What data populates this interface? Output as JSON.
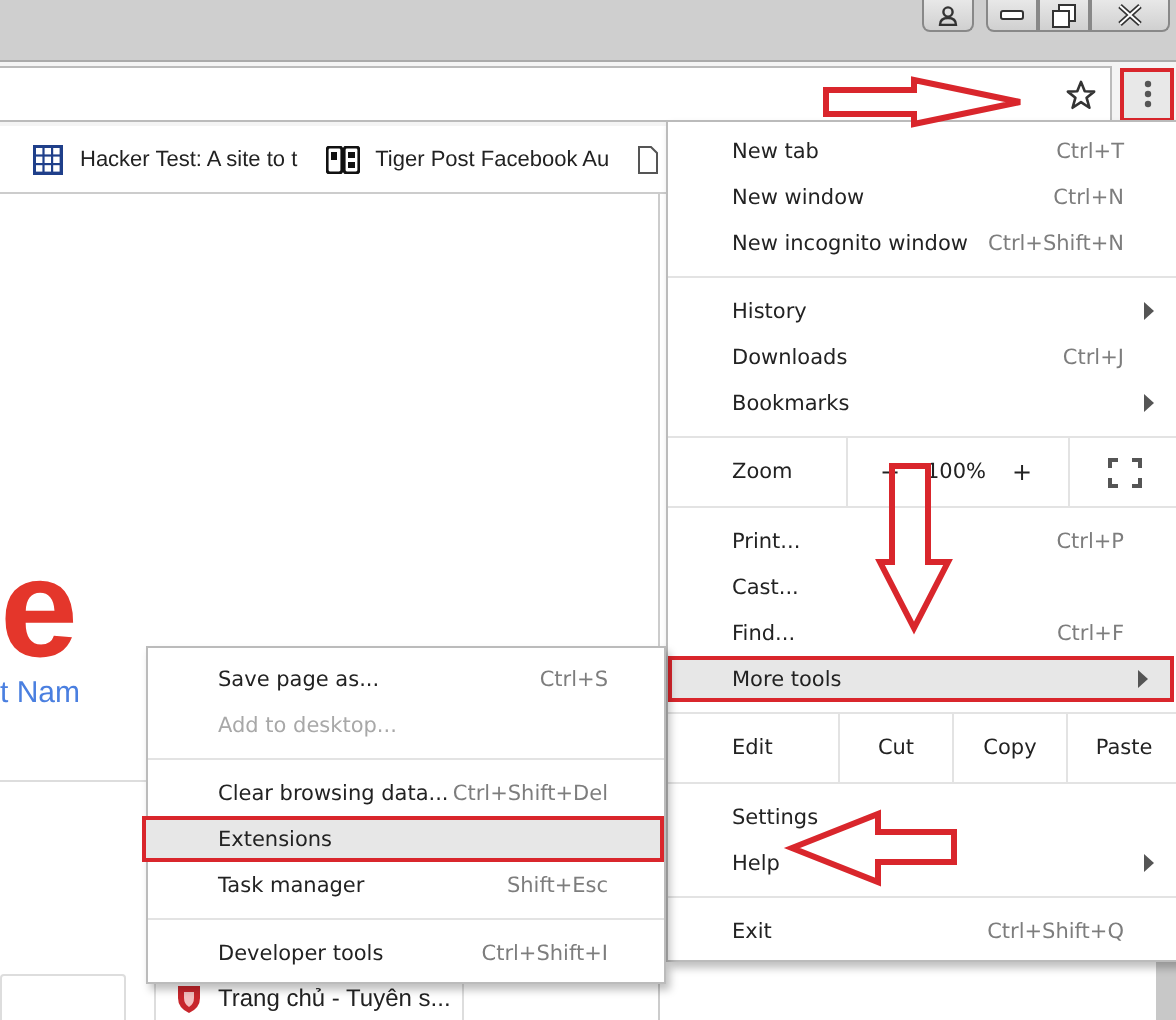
{
  "toolbar": {
    "menu_button_marked": true
  },
  "bookmarks": [
    {
      "kind": "grid",
      "title": "Hacker Test: A site to t"
    },
    {
      "kind": "ps",
      "title": "Tiger Post Facebook Au"
    },
    {
      "kind": "doc"
    }
  ],
  "page": {
    "logo_fragment": "e",
    "subtitle": "t Nam",
    "tab_title": "Trang chủ - Tuyên s..."
  },
  "menu": [
    {
      "kind": "item",
      "label": "New tab",
      "shortcut": "Ctrl+T",
      "selected": false,
      "marked": false,
      "submenu": false
    },
    {
      "kind": "item",
      "label": "New window",
      "shortcut": "Ctrl+N",
      "selected": false,
      "marked": false,
      "submenu": false
    },
    {
      "kind": "item",
      "label": "New incognito window",
      "shortcut": "Ctrl+Shift+N",
      "selected": false,
      "marked": false,
      "submenu": false
    },
    {
      "kind": "separator"
    },
    {
      "kind": "item",
      "label": "History",
      "selected": false,
      "marked": false,
      "submenu": true
    },
    {
      "kind": "item",
      "label": "Downloads",
      "shortcut": "Ctrl+J",
      "selected": false,
      "marked": false,
      "submenu": false
    },
    {
      "kind": "item",
      "label": "Bookmarks",
      "selected": false,
      "marked": false,
      "submenu": true
    },
    {
      "kind": "separator"
    },
    {
      "kind": "zoom",
      "label": "Zoom",
      "minus": "−",
      "value": "100%",
      "plus": "+"
    },
    {
      "kind": "separator"
    },
    {
      "kind": "item",
      "label": "Print...",
      "shortcut": "Ctrl+P",
      "selected": false,
      "marked": false,
      "submenu": false
    },
    {
      "kind": "item",
      "label": "Cast...",
      "selected": false,
      "marked": false,
      "submenu": false
    },
    {
      "kind": "item",
      "label": "Find...",
      "shortcut": "Ctrl+F",
      "selected": false,
      "marked": false,
      "submenu": false
    },
    {
      "kind": "item",
      "label": "More tools",
      "selected": true,
      "marked": true,
      "submenu": true
    },
    {
      "kind": "separator"
    },
    {
      "kind": "edit",
      "label": "Edit",
      "buttons": [
        "Cut",
        "Copy",
        "Paste"
      ]
    },
    {
      "kind": "separator"
    },
    {
      "kind": "item",
      "label": "Settings",
      "selected": false,
      "marked": false,
      "submenu": false
    },
    {
      "kind": "item",
      "label": "Help",
      "selected": false,
      "marked": false,
      "submenu": true
    },
    {
      "kind": "separator"
    },
    {
      "kind": "item",
      "label": "Exit",
      "shortcut": "Ctrl+Shift+Q",
      "selected": false,
      "marked": false,
      "submenu": false
    }
  ],
  "submenu": [
    {
      "kind": "item",
      "label": "Save page as...",
      "shortcut": "Ctrl+S",
      "selected": false,
      "marked": false,
      "disabled": false
    },
    {
      "kind": "item",
      "label": "Add to desktop...",
      "selected": false,
      "marked": false,
      "disabled": true
    },
    {
      "kind": "separator"
    },
    {
      "kind": "item",
      "label": "Clear browsing data...",
      "shortcut": "Ctrl+Shift+Del",
      "selected": false,
      "marked": false,
      "disabled": false
    },
    {
      "kind": "item",
      "label": "Extensions",
      "selected": true,
      "marked": true,
      "disabled": false
    },
    {
      "kind": "item",
      "label": "Task manager",
      "shortcut": "Shift+Esc",
      "selected": false,
      "marked": false,
      "disabled": false
    },
    {
      "kind": "separator"
    },
    {
      "kind": "item",
      "label": "Developer tools",
      "shortcut": "Ctrl+Shift+I",
      "selected": false,
      "marked": false,
      "disabled": false
    }
  ],
  "annotations": [
    {
      "kind": "right-arrow"
    },
    {
      "kind": "down-arrow"
    },
    {
      "kind": "left-arrow"
    }
  ]
}
